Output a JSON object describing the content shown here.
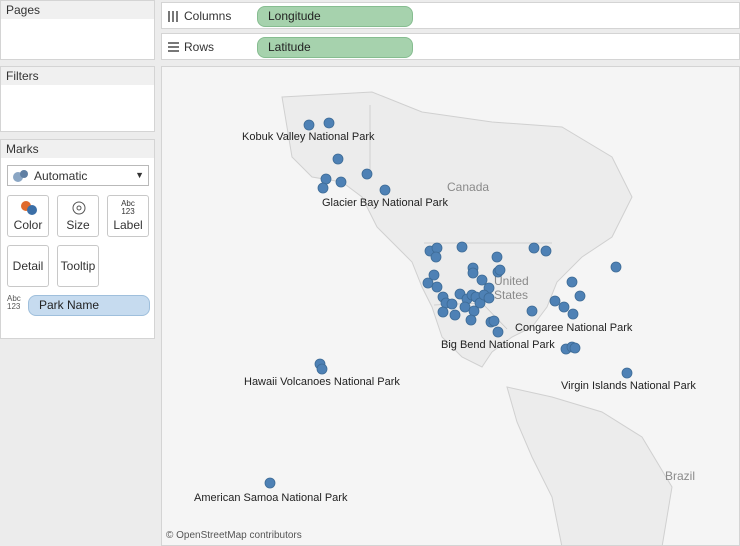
{
  "pages": {
    "title": "Pages"
  },
  "filters": {
    "title": "Filters"
  },
  "marks": {
    "title": "Marks",
    "mark_type": "Automatic",
    "buttons": {
      "color": "Color",
      "size": "Size",
      "label": "Label",
      "detail": "Detail",
      "tooltip": "Tooltip"
    },
    "label_icon_text": "Abc 123",
    "field_type_text": "Abc 123",
    "field_pill": "Park Name"
  },
  "shelves": {
    "columns": {
      "label": "Columns",
      "pill": "Longitude"
    },
    "rows": {
      "label": "Rows",
      "pill": "Latitude"
    }
  },
  "map": {
    "attribution": "© OpenStreetMap contributors",
    "geo_labels": {
      "canada": "Canada",
      "united": "United",
      "states": "States",
      "brazil": "Brazil"
    },
    "park_labels": {
      "kobuk": "Kobuk Valley National Park",
      "glacier_bay": "Glacier Bay National Park",
      "congaree": "Congaree National Park",
      "big_bend": "Big Bend National Park",
      "hawaii": "Hawaii Volcanoes National Park",
      "virgin_islands": "Virgin Islands National Park",
      "american_samoa": "American Samoa National Park"
    },
    "mark_color": "#4e81b5"
  }
}
